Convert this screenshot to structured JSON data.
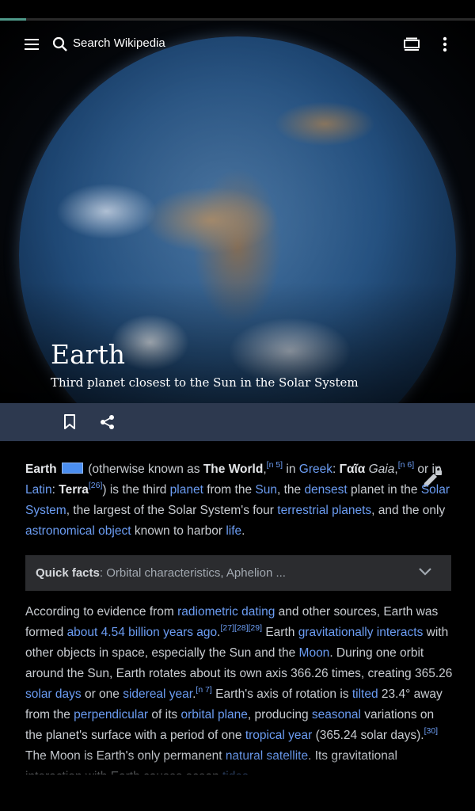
{
  "toolbar": {
    "search_placeholder": "Search Wikipedia",
    "menu_icon": "menu-icon",
    "search_icon": "search-icon",
    "tabs_icon": "tabs-icon",
    "overflow_icon": "more-vert-icon"
  },
  "page_load_progress": 0.055,
  "article": {
    "title": "Earth",
    "description": "Third planet closest to the Sun in the Solar System"
  },
  "actions": {
    "save_icon": "bookmark-icon",
    "share_icon": "share-icon",
    "edit_icon": "edit-lock-icon"
  },
  "lead": {
    "earth": "Earth",
    "t1": " (otherwise known as ",
    "the_world": "The World",
    "t2": ",",
    "ref_n5": "[n 5]",
    "t3": " in ",
    "greek": "Greek",
    "t4": ": ",
    "gaia_greek": "Γαῖα",
    "t5": " ",
    "gaia": "Gaia",
    "t6": ",",
    "ref_n6": "[n 6]",
    "t7": " or in ",
    "latin": "Latin",
    "t8": ": ",
    "terra": "Terra",
    "ref_26": "[26]",
    "t9": ") is the third ",
    "planet": "planet",
    "t10": " from the ",
    "sun": "Sun",
    "t11": ", the ",
    "densest": "densest",
    "t12": " planet in the ",
    "solar_system": "Solar System",
    "t13": ", the largest of the Solar System's four ",
    "terrestrial_planets": "terrestrial planets",
    "t14": ", and the only ",
    "astronomical_object": "astronomical object",
    "t15": " known to harbor ",
    "life": "life",
    "t16": "."
  },
  "quick_facts": {
    "label": "Quick facts",
    "summary": ": Orbital characteristics, Aphelion ..."
  },
  "para2": {
    "t1": "According to evidence from ",
    "radiometric_dating": "radiometric dating",
    "t2": " and other sources, Earth was formed ",
    "age": "about 4.54 billion years ago",
    "t3": ".",
    "ref_27": "[27]",
    "ref_28": "[28]",
    "ref_29": "[29]",
    "t4": " Earth ",
    "gravitationally_interacts": "gravitationally interacts",
    "t5": " with other objects in space, especially the Sun and the ",
    "moon": "Moon",
    "t6": ". During one orbit around the Sun, Earth rotates about its own axis 366.26 times, creating 365.26 ",
    "solar_days": "solar days",
    "t7": " or one ",
    "sidereal_year": "sidereal year",
    "t8": ".",
    "ref_n7": "[n 7]",
    "t9": " Earth's axis of rotation is ",
    "tilted": "tilted",
    "t10": " 23.4° away from the ",
    "perpendicular": "perpendicular",
    "t11": " of its ",
    "orbital_plane": "orbital plane",
    "t12": ", producing ",
    "seasonal": "seasonal",
    "t13": " variations on the planet's surface with a period of one ",
    "tropical_year": "tropical year",
    "t14": " (365.24 solar days).",
    "ref_30": "[30]",
    "t15": " The Moon is Earth's only permanent ",
    "natural_satellite": "natural satellite",
    "t16": ". Its gravitational interaction with Earth causes ocean ",
    "tides": "tides"
  },
  "colors": {
    "link": "#6b9cf2",
    "actionbar": "#2d394f",
    "quickfacts_bg": "#2b2c2f",
    "progress": "#4f9a8a"
  }
}
